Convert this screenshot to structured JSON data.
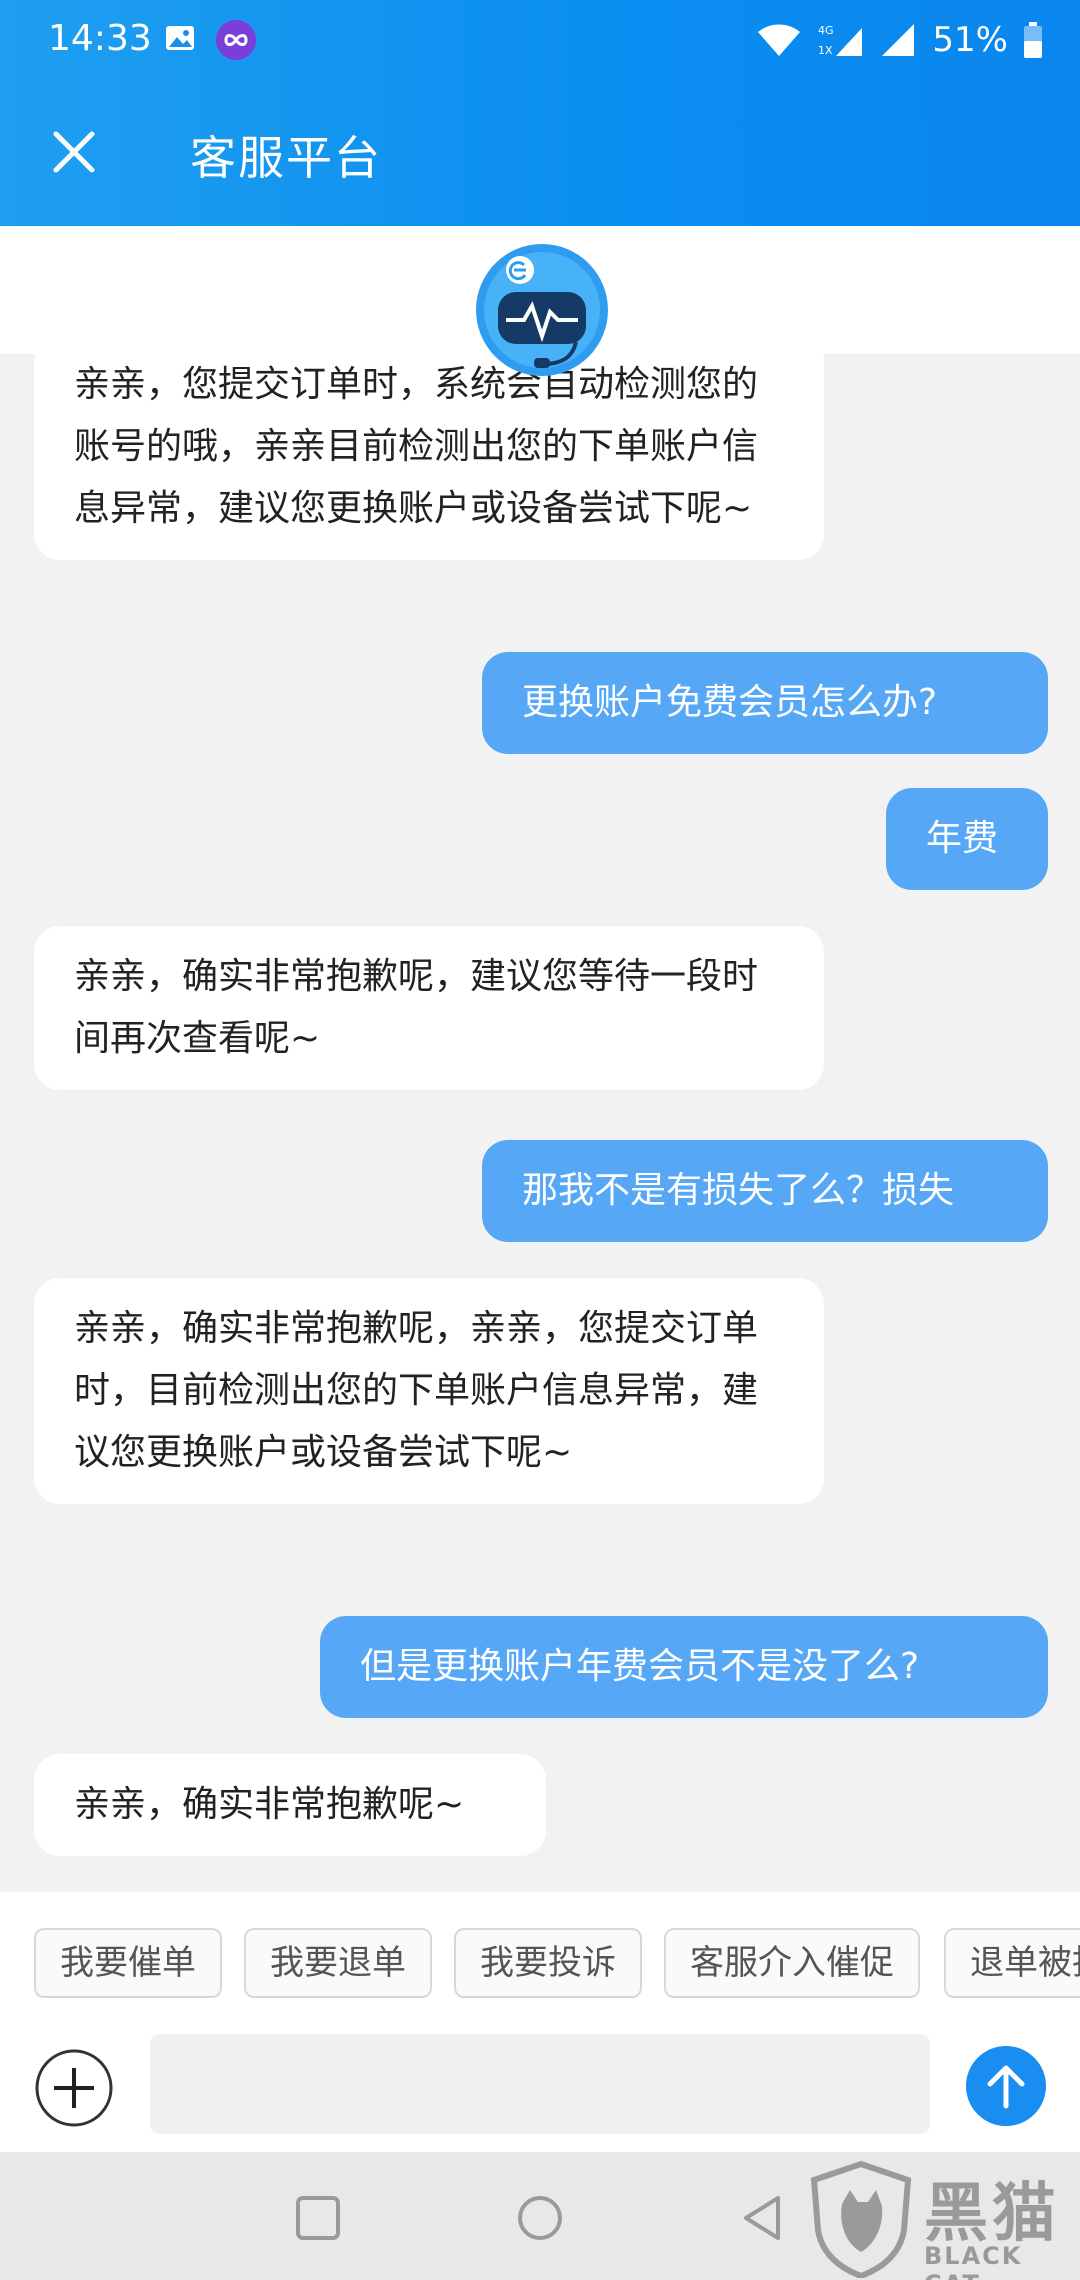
{
  "status_bar": {
    "time": "14:33",
    "network": "4G",
    "network_sub": "1X",
    "battery": "51%"
  },
  "header": {
    "title": "客服平台"
  },
  "messages": [
    {
      "side": "left",
      "text": "亲亲，您提交订单时，系统会自动检测您的账号的哦，亲亲目前检测出您的下单账户信息异常，建议您更换账户或设备尝试下呢~"
    },
    {
      "side": "right",
      "text": "更换账户免费会员怎么办?"
    },
    {
      "side": "right",
      "text": "年费"
    },
    {
      "side": "left",
      "text": "亲亲，确实非常抱歉呢，建议您等待一段时间再次查看呢~"
    },
    {
      "side": "right",
      "text": "那我不是有损失了么？损失"
    },
    {
      "side": "left",
      "text": "亲亲，确实非常抱歉呢，亲亲，您提交订单时，目前检测出您的下单账户信息异常，建议您更换账户或设备尝试下呢~"
    },
    {
      "side": "right",
      "text": "但是更换账户年费会员不是没了么?"
    },
    {
      "side": "left",
      "text": "亲亲，确实非常抱歉呢~"
    }
  ],
  "quick_replies": [
    "我要催单",
    "我要退单",
    "我要投诉",
    "客服介入催促",
    "退单被拒"
  ],
  "input": {
    "placeholder": ""
  },
  "watermark": {
    "cn": "黑猫",
    "en": "BLACK CAT"
  },
  "colors": {
    "header": "#0a8ef0",
    "bubble_right": "#56a8f6",
    "send": "#1a8df0"
  }
}
